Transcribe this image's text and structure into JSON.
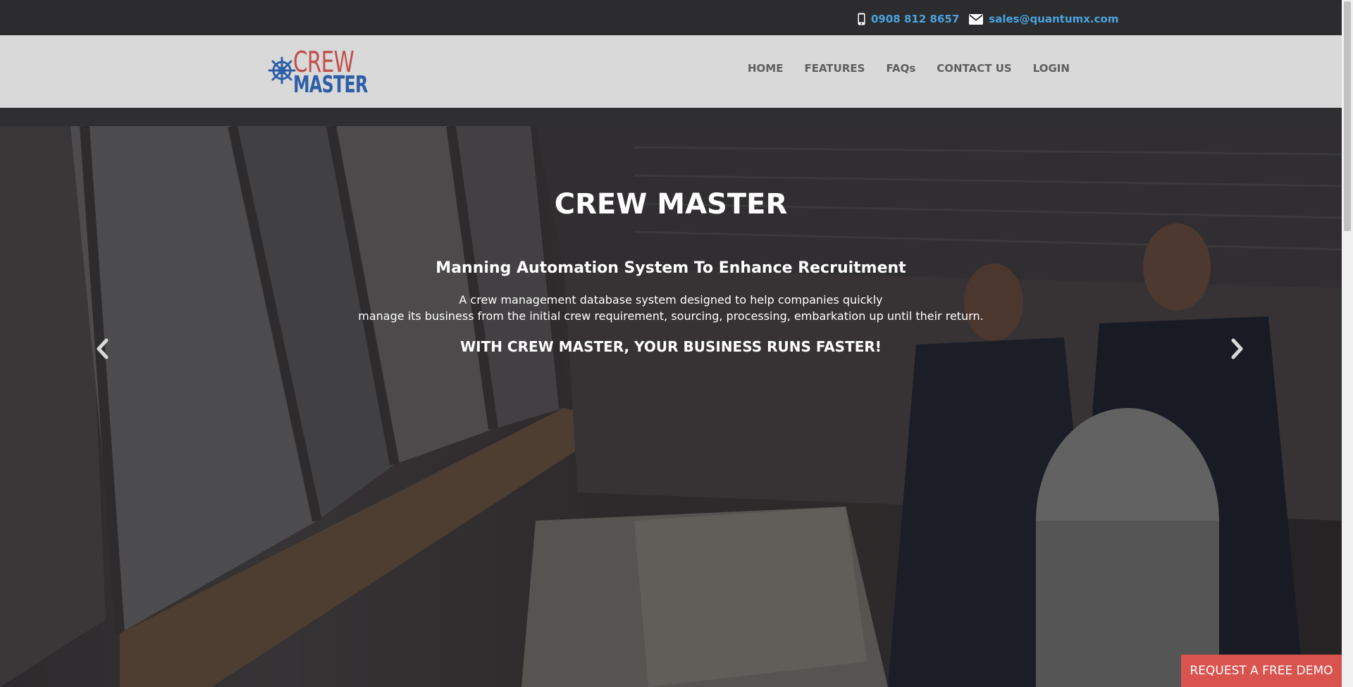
{
  "topbar": {
    "phone": "0908 812 8657",
    "email": "sales@quantumx.com",
    "phone_icon": "mobile-phone-icon",
    "email_icon": "envelope-icon"
  },
  "logo": {
    "line1": "CREW",
    "line2": "MASTER",
    "icon": "ship-wheel-icon",
    "colors": {
      "crew": "#c0504d",
      "master": "#2f5ea8"
    }
  },
  "nav": {
    "items": [
      {
        "label": "HOME"
      },
      {
        "label": "FEATURES"
      },
      {
        "label": "FAQs"
      },
      {
        "label": "CONTACT US"
      },
      {
        "label": "LOGIN"
      }
    ]
  },
  "hero": {
    "title": "CREW MASTER",
    "subtitle": "Manning Automation System To Enhance Recruitment",
    "description_line1": "A crew management database system designed to help companies quickly",
    "description_line2": "manage its business from the initial crew requirement, sourcing, processing, embarkation up until their return.",
    "tagline": "WITH CREW MASTER, YOUR BUSINESS RUNS FASTER!",
    "prev_icon": "chevron-left-icon",
    "next_icon": "chevron-right-icon"
  },
  "cta": {
    "label": "REQUEST A FREE DEMO",
    "color": "#d9534f"
  },
  "colors": {
    "link": "#4aa3df",
    "nav_text": "#5e5e5e",
    "header_bg": "#d9d9d9",
    "topbar_bg": "#2c2c2e"
  }
}
